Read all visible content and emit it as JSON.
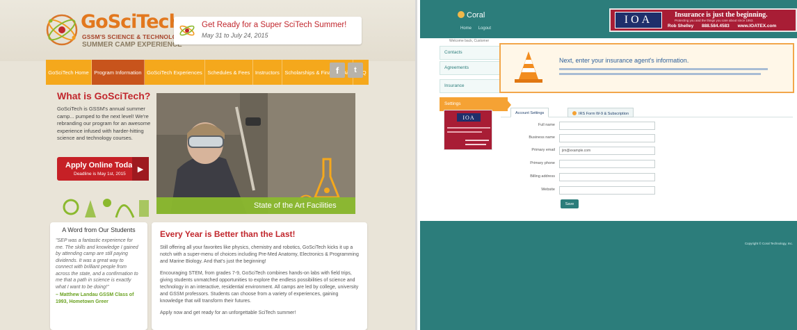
{
  "gosci": {
    "logo": {
      "brand": "GoSciTech",
      "tag1": "GSSM'S SCIENCE & TECHNOLOGY",
      "tag2": "SUMMER CAMP EXPERIENCE"
    },
    "banner": {
      "title": "Get Ready for a Super SciTech Summer!",
      "dates": "May 31 to July 24, 2015"
    },
    "nav": [
      "GoSciTech Home",
      "Program Information",
      "GoSciTech Experiences",
      "Schedules & Fees",
      "Instructors",
      "Scholarships & Financial Aid",
      "FAQ"
    ],
    "nav_active_index": 1,
    "social": {
      "facebook": "f",
      "twitter": "t"
    },
    "what": {
      "title": "What is GoSciTech?",
      "body": "GoSciTech is GSSM's annual summer camp... pumped to the next level! We're rebranding our program for an awesome experience infused with harder-hitting science and technology courses."
    },
    "apply": {
      "label": "Apply Online Today",
      "deadline": "Deadline is May 1st, 2015",
      "arrow": "▶"
    },
    "photo_caption": "State of the Art Facilities",
    "quote": {
      "title": "A Word from Our Students",
      "body": "\"SEP was a fantastic experience for me. The skills and knowledge I gained by attending camp are still paying dividends. It was a great way to connect with brilliant people from across the state, and a confirmation to me that a path in science is exactly what I want to be doing!\"",
      "author": "– Matthew Landau GSSM Class of 1993, Hometown Greer"
    },
    "main": {
      "title": "Every Year is Better than the Last!",
      "p1": "Still offering all your favorites like physics, chemistry and robotics, GoSciTech kicks it up a notch with a super-menu of choices including Pre-Med Anatomy, Electronics & Programming and Marine Biology. And that's just the beginning!",
      "p2": "Encouraging STEM, from grades 7-9, GoSciTech combines hands-on labs with field trips, giving students unmatched opportunities to explore the endless possibilities of science and technology in an interactive, residential environment. All camps are led by college, university and GSSM professors. Students can choose from a variety of experiences, gaining knowledge that will transform their futures.",
      "p3": "Apply now and get ready for an unforgettable SciTech summer!"
    }
  },
  "coral": {
    "brand": "Coral",
    "sublinks": [
      "Home",
      "Logout"
    ],
    "crumb": "Welcome back, Customer",
    "ioa": {
      "logo": "IOA",
      "slogan": "Insurance is just the beginning.",
      "fine": "Protecting you and the things you care about since 1953.",
      "agent": "Rob Shelley",
      "phone": "888.584.4583",
      "site": "www.IOATEX.com"
    },
    "sidebar": [
      "Contacts",
      "Agreements",
      "Insurance",
      "Settings"
    ],
    "sidebar_active_index": 3,
    "notice": {
      "title": "Next, enter your insurance agent's information."
    },
    "tabs": [
      "Account Settings",
      "IRS Form W-9 & Subscription"
    ],
    "form": {
      "fields": [
        {
          "label": "Full name",
          "value": ""
        },
        {
          "label": "Business name",
          "value": ""
        },
        {
          "label": "Primary email",
          "value": "jim@example.com"
        },
        {
          "label": "Primary phone",
          "value": ""
        },
        {
          "label": "Billing address",
          "value": ""
        },
        {
          "label": "Website",
          "value": ""
        }
      ],
      "save": "Save"
    },
    "footer": "Copyright © Coral Technology, Inc."
  }
}
